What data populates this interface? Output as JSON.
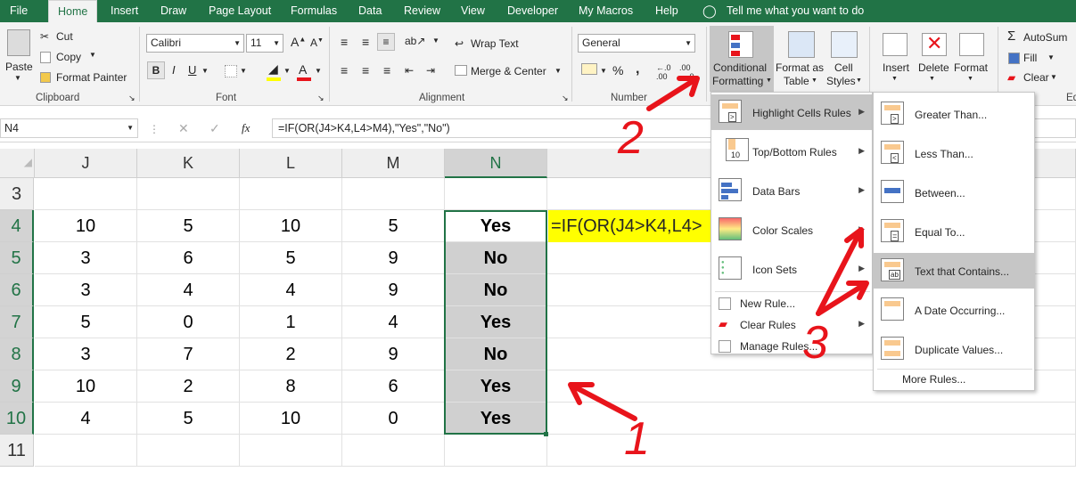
{
  "tabs": [
    "File",
    "Home",
    "Insert",
    "Draw",
    "Page Layout",
    "Formulas",
    "Data",
    "Review",
    "View",
    "Developer",
    "My Macros",
    "Help"
  ],
  "tell_me": "Tell me what you want to do",
  "clipboard": {
    "paste": "Paste",
    "cut": "Cut",
    "copy": "Copy",
    "format_painter": "Format Painter",
    "group": "Clipboard"
  },
  "font": {
    "name": "Calibri",
    "size": "11",
    "group": "Font"
  },
  "alignment": {
    "wrap": "Wrap Text",
    "merge": "Merge & Center",
    "group": "Alignment"
  },
  "number": {
    "format": "General",
    "group": "Number",
    "percent": "%",
    "comma": ","
  },
  "styles": {
    "cond1": "Conditional",
    "cond2": "Formatting",
    "fat1": "Format as",
    "fat2": "Table",
    "cs1": "Cell",
    "cs2": "Styles"
  },
  "cells": {
    "insert": "Insert",
    "delete": "Delete",
    "format": "Format"
  },
  "editing": {
    "autosum": "AutoSum",
    "fill": "Fill",
    "clear": "Clear",
    "group": "Ed"
  },
  "formula_bar": {
    "name_box": "N4",
    "fx": "fx",
    "formula": "=IF(OR(J4>K4,L4>M4),\"Yes\",\"No\")"
  },
  "columns": [
    "J",
    "K",
    "L",
    "M",
    "N"
  ],
  "rows": [
    {
      "n": "3",
      "J": "",
      "K": "",
      "L": "",
      "M": "",
      "N": ""
    },
    {
      "n": "4",
      "J": "10",
      "K": "5",
      "L": "10",
      "M": "5",
      "N": "Yes"
    },
    {
      "n": "5",
      "J": "3",
      "K": "6",
      "L": "5",
      "M": "9",
      "N": "No"
    },
    {
      "n": "6",
      "J": "3",
      "K": "4",
      "L": "4",
      "M": "9",
      "N": "No"
    },
    {
      "n": "7",
      "J": "5",
      "K": "0",
      "L": "1",
      "M": "4",
      "N": "Yes"
    },
    {
      "n": "8",
      "J": "3",
      "K": "7",
      "L": "2",
      "M": "9",
      "N": "No"
    },
    {
      "n": "9",
      "J": "10",
      "K": "2",
      "L": "8",
      "M": "6",
      "N": "Yes"
    },
    {
      "n": "10",
      "J": "4",
      "K": "5",
      "L": "10",
      "M": "0",
      "N": "Yes"
    },
    {
      "n": "11",
      "J": "",
      "K": "",
      "L": "",
      "M": "",
      "N": ""
    }
  ],
  "overflow_text": "=IF(OR(J4>K4,L4>",
  "cf_menu": {
    "highlight": "Highlight Cells Rules",
    "topbottom": "Top/Bottom Rules",
    "databars": "Data Bars",
    "colorscales": "Color Scales",
    "iconsets": "Icon Sets",
    "new": "New Rule...",
    "clear": "Clear Rules",
    "manage": "Manage Rules..."
  },
  "hl_menu": {
    "greater": "Greater Than...",
    "less": "Less Than...",
    "between": "Between...",
    "equal": "Equal To...",
    "text": "Text that Contains...",
    "date": "A Date Occurring...",
    "dup": "Duplicate Values...",
    "more": "More Rules..."
  },
  "icon_text": {
    "top10": "10",
    "ab": "ab",
    "gt": ">",
    "lt": "<"
  },
  "annotations": {
    "a1": "1",
    "a2": "2",
    "a3": "3"
  },
  "colors": {
    "excel_green": "#217346",
    "annotation_red": "#e8141b",
    "highlight_yellow": "#ffff00"
  }
}
